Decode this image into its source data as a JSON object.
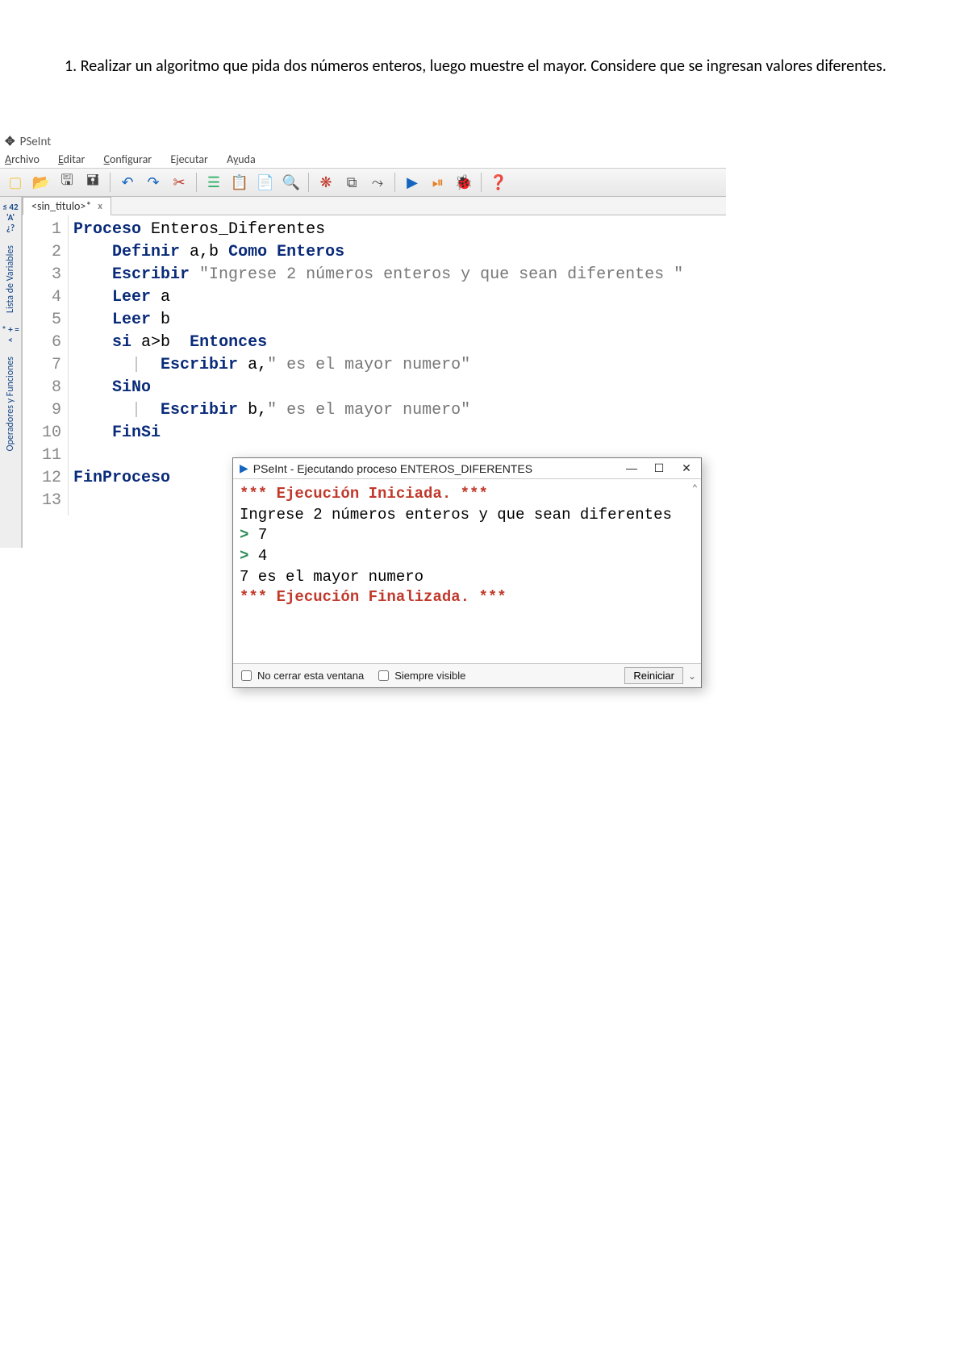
{
  "problem": {
    "number": "1.",
    "text": "Realizar un algoritmo que pida dos números enteros, luego muestre el mayor. Considere que se ingresan valores diferentes."
  },
  "ide": {
    "app_title": "PSeInt",
    "menu": {
      "archivo": "Archivo",
      "editar": "Editar",
      "configurar": "Configurar",
      "ejecutar": "Ejecutar",
      "ayuda": "Ayuda"
    },
    "file_tab": {
      "label": "<sin_titulo>*",
      "close": "x"
    },
    "left_panel": {
      "sym1": "≤\n42\n'A'\n¿?",
      "varlist": "Lista de Variables",
      "sym2": "*\n+\n=\n<",
      "ops": "Operadores y Funciones"
    },
    "code": {
      "lines": [
        {
          "n": "1",
          "html": "<span class='kw'>Proceso</span> <span class='name'>Enteros_Diferentes</span>"
        },
        {
          "n": "2",
          "html": "    <span class='kw'>Definir</span> <span class='var'>a,b</span> <span class='kw'>Como Enteros</span>"
        },
        {
          "n": "3",
          "html": "    <span class='kw'>Escribir</span> <span class='str'>\"Ingrese 2 números enteros y que sean diferentes \"</span>"
        },
        {
          "n": "4",
          "html": "    <span class='kw'>Leer</span> <span class='var'>a</span>"
        },
        {
          "n": "5",
          "html": "    <span class='kw'>Leer</span> <span class='var'>b</span>"
        },
        {
          "n": "6",
          "html": "    <span class='kw'>si</span> <span class='var'>a&gt;b</span>  <span class='kw'>Entonces</span>"
        },
        {
          "n": "7",
          "html": "      <span class='pipe'>|</span>  <span class='kw'>Escribir</span> <span class='var'>a</span>,<span class='str'>\" es el mayor numero\"</span>"
        },
        {
          "n": "8",
          "html": "    <span class='kw'>SiNo</span>"
        },
        {
          "n": "9",
          "html": "      <span class='pipe'>|</span>  <span class='kw'>Escribir</span> <span class='var'>b</span>,<span class='str'>\" es el mayor numero\"</span>"
        },
        {
          "n": "10",
          "html": "    <span class='kw'>FinSi</span>"
        },
        {
          "n": "11",
          "html": ""
        },
        {
          "n": "12",
          "html": "<span class='kw'>FinProceso</span>"
        },
        {
          "n": "13",
          "html": ""
        }
      ]
    }
  },
  "exec": {
    "title": "PSeInt - Ejecutando proceso ENTEROS_DIFERENTES",
    "controls": {
      "min": "—",
      "max": "☐",
      "close": "✕"
    },
    "lines": {
      "start": "*** Ejecución Iniciada. ***",
      "prompt": "Ingrese 2 números enteros y que sean diferentes",
      "in1_sym": ">",
      "in1_val": "7",
      "in2_sym": ">",
      "in2_val": "4",
      "result": "7 es el mayor numero",
      "end": "*** Ejecución Finalizada. ***"
    },
    "footer": {
      "chk1": "No cerrar esta ventana",
      "chk2": "Siempre visible",
      "btn": "Reiniciar"
    }
  },
  "toolbar_icons": [
    {
      "name": "new-icon",
      "glyph": "▢",
      "color": "#f2c94c"
    },
    {
      "name": "open-icon",
      "glyph": "📂",
      "color": "#c78b2a"
    },
    {
      "name": "save-icon",
      "glyph": "🖫",
      "color": "#444"
    },
    {
      "name": "saveas-icon",
      "glyph": "🖬",
      "color": "#444"
    },
    {
      "name": "sep1",
      "sep": true
    },
    {
      "name": "undo-icon",
      "glyph": "↶",
      "color": "#1565c0"
    },
    {
      "name": "redo-icon",
      "glyph": "↷",
      "color": "#1565c0"
    },
    {
      "name": "cut-icon",
      "glyph": "✂",
      "color": "#c0392b"
    },
    {
      "name": "sep2",
      "sep": true
    },
    {
      "name": "indent-icon",
      "glyph": "☰",
      "color": "#27ae60"
    },
    {
      "name": "copy-icon",
      "glyph": "📋",
      "color": "#555"
    },
    {
      "name": "paste-icon",
      "glyph": "📄",
      "color": "#555"
    },
    {
      "name": "find-icon",
      "glyph": "🔍",
      "color": "#555"
    },
    {
      "name": "sep3",
      "sep": true
    },
    {
      "name": "check-icon",
      "glyph": "❋",
      "color": "#c0392b"
    },
    {
      "name": "flow-icon",
      "glyph": "⧉",
      "color": "#555"
    },
    {
      "name": "flow2-icon",
      "glyph": "⤳",
      "color": "#555"
    },
    {
      "name": "sep4",
      "sep": true
    },
    {
      "name": "run-icon",
      "glyph": "▶",
      "color": "#1565c0"
    },
    {
      "name": "step-icon",
      "glyph": "⏯",
      "color": "#e67e22"
    },
    {
      "name": "debug-icon",
      "glyph": "🐞",
      "color": "#555"
    },
    {
      "name": "sep5",
      "sep": true
    },
    {
      "name": "help-icon",
      "glyph": "❓",
      "color": "#1565c0"
    }
  ]
}
